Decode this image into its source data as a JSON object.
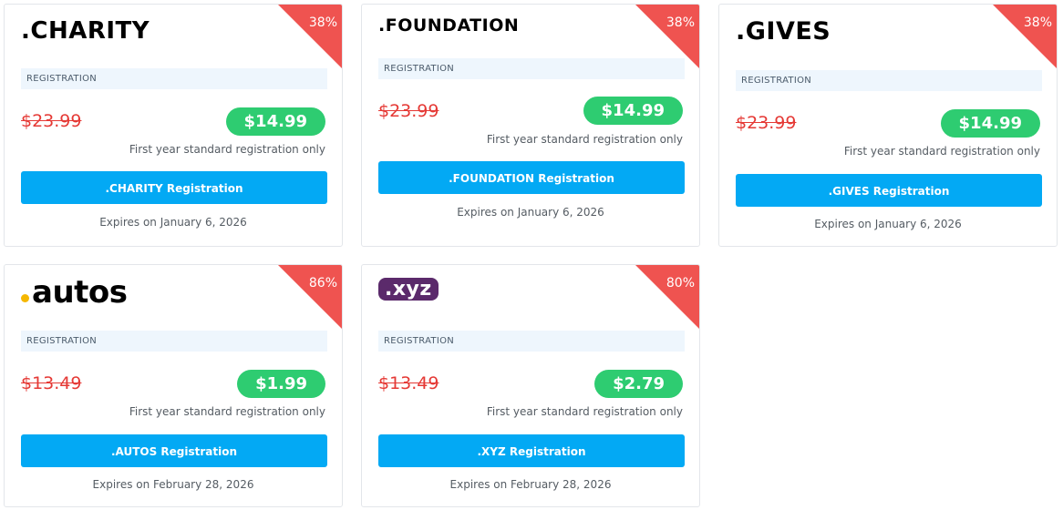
{
  "cards": [
    {
      "logo": ".CHARITY",
      "discount": "38%",
      "label": "REGISTRATION",
      "old_price": "$23.99",
      "new_price": "$14.99",
      "note": "First year standard registration only",
      "button": ".CHARITY Registration",
      "expires": "Expires on January 6, 2026"
    },
    {
      "logo": ".FOUNDATION",
      "discount": "38%",
      "label": "REGISTRATION",
      "old_price": "$23.99",
      "new_price": "$14.99",
      "note": "First year standard registration only",
      "button": ".FOUNDATION Registration",
      "expires": "Expires on January 6, 2026"
    },
    {
      "logo": ".GIVES",
      "discount": "38%",
      "label": "REGISTRATION",
      "old_price": "$23.99",
      "new_price": "$14.99",
      "note": "First year standard registration only",
      "button": ".GIVES Registration",
      "expires": "Expires on January 6, 2026"
    },
    {
      "logo": "autos",
      "discount": "86%",
      "label": "REGISTRATION",
      "old_price": "$13.49",
      "new_price": "$1.99",
      "note": "First year standard registration only",
      "button": ".AUTOS Registration",
      "expires": "Expires on February 28, 2026"
    },
    {
      "logo": ".xyz",
      "discount": "80%",
      "label": "REGISTRATION",
      "old_price": "$13.49",
      "new_price": "$2.79",
      "note": "First year standard registration only",
      "button": ".XYZ Registration",
      "expires": "Expires on February 28, 2026"
    }
  ],
  "colors": {
    "ribbon": "#ef5350",
    "price_badge": "#2ecc71",
    "button": "#03a9f4",
    "old_price": "#e53935",
    "label_bg": "#eef6fd"
  }
}
